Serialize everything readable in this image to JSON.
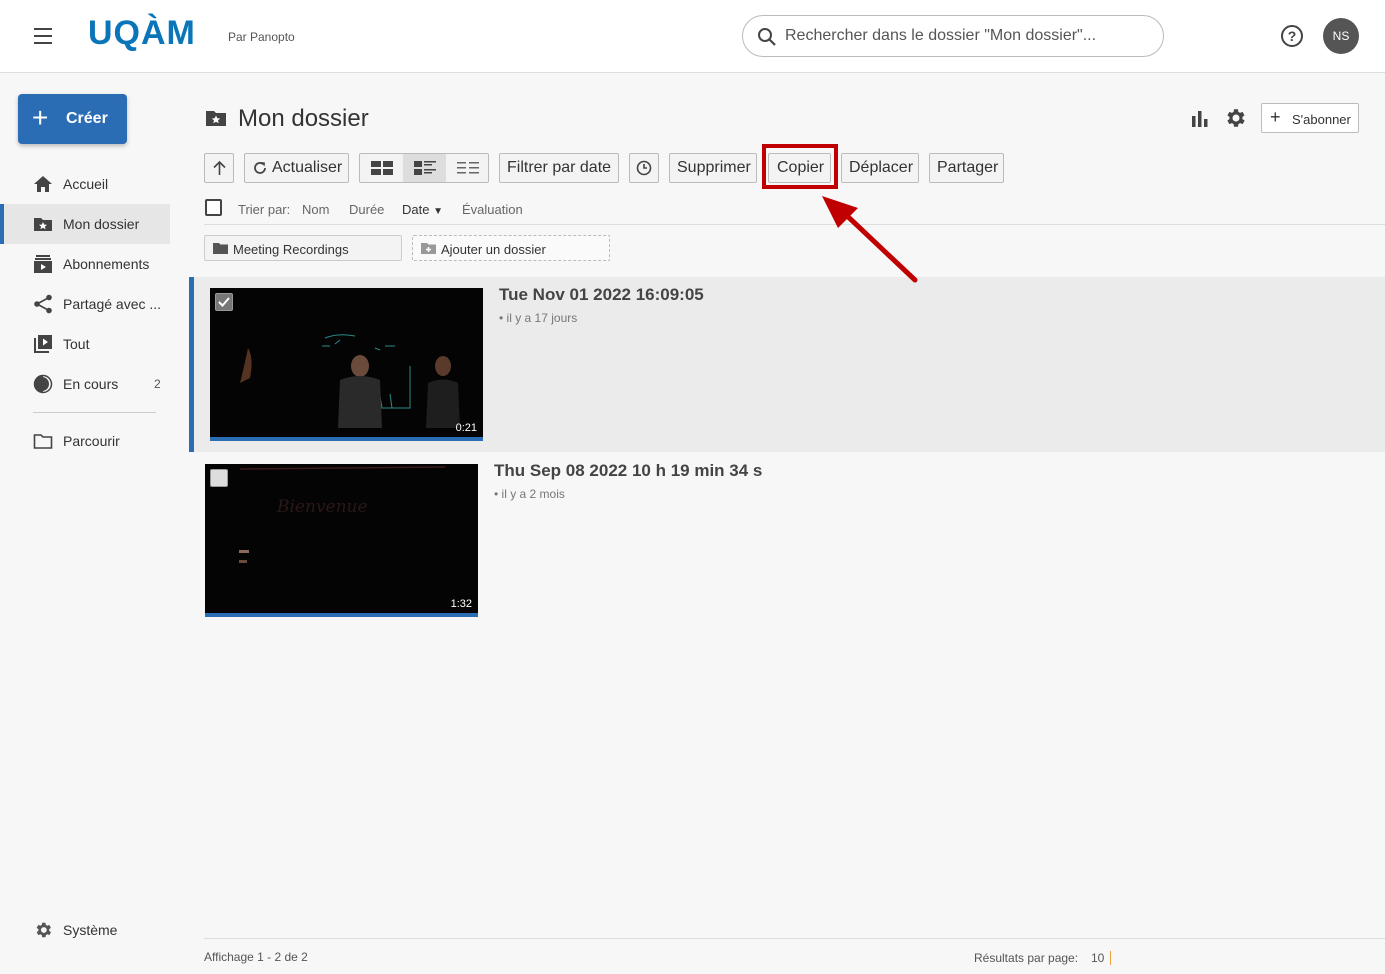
{
  "header": {
    "logo": "UQÀM",
    "by_panopto": "Par Panopto",
    "search_placeholder": "Rechercher dans le dossier \"Mon dossier\"...",
    "help_label": "?",
    "avatar_initials": "NS"
  },
  "sidebar": {
    "create_label": "Créer",
    "items": [
      {
        "label": "Accueil",
        "icon": "home-icon"
      },
      {
        "label": "Mon dossier",
        "icon": "folder-star-icon",
        "active": true
      },
      {
        "label": "Abonnements",
        "icon": "subscriptions-icon"
      },
      {
        "label": "Partagé avec ...",
        "icon": "share-icon"
      },
      {
        "label": "Tout",
        "icon": "play-library-icon"
      },
      {
        "label": "En cours",
        "icon": "in-progress-icon",
        "count": "2"
      },
      {
        "label": "Parcourir",
        "icon": "folder-outline-icon"
      }
    ],
    "system_label": "Système"
  },
  "main": {
    "title": "Mon dossier",
    "subscribe_label": "S'abonner",
    "toolbar": {
      "refresh_label": "Actualiser",
      "filter_date_label": "Filtrer par date",
      "delete_label": "Supprimer",
      "copy_label": "Copier",
      "move_label": "Déplacer",
      "share_label": "Partager"
    },
    "sort": {
      "label": "Trier par:",
      "options": [
        "Nom",
        "Durée",
        "Date",
        "Évaluation"
      ],
      "active": "Date"
    },
    "folders": {
      "meeting_recordings": "Meeting Recordings",
      "add_folder": "Ajouter un dossier"
    },
    "sessions": [
      {
        "title": "Tue Nov 01 2022 16:09:05",
        "meta": "• il y a 17 jours",
        "duration": "0:21",
        "selected": true
      },
      {
        "title": "Thu Sep 08 2022 10 h 19 min 34 s",
        "meta": "• il y a 2 mois",
        "duration": "1:32",
        "selected": false
      }
    ]
  },
  "footer": {
    "showing": "Affichage 1 - 2 de 2",
    "results_label": "Résultats par page:",
    "results_value": "10"
  },
  "colors": {
    "brand": "#0a76b9",
    "accent": "#2a6db5",
    "highlight": "#c00000"
  }
}
